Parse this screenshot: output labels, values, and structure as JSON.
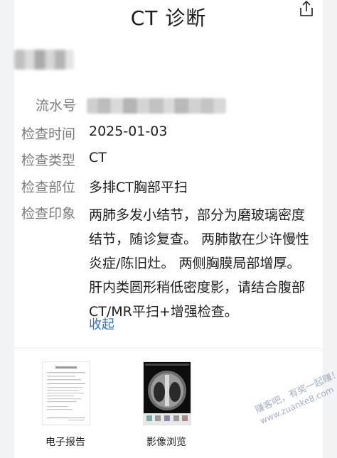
{
  "header": {
    "title": "CT 诊断",
    "share_icon": "share-icon"
  },
  "patient": {
    "name_redacted": true
  },
  "fields": {
    "serial_label": "流水号",
    "exam_time_label": "检查时间",
    "exam_time_value": "2025-01-03",
    "exam_type_label": "检查类型",
    "exam_type_value": "CT",
    "exam_site_label": "检查部位",
    "exam_site_value": "多排CT胸部平扫",
    "impression_label": "检查印象",
    "impression_value": "两肺多发小结节，部分为磨玻璃密度结节，随诊复查。 两肺散在少许慢性炎症/陈旧灶。 两侧胸膜局部增厚。 肝内类圆形稍低密度影，请结合腹部CT/MR平扫+增强检查。",
    "collapse_link": "收起"
  },
  "attachments": [
    {
      "label": "电子报告",
      "icon": "report-document-thumbnail"
    },
    {
      "label": "影像浏览",
      "icon": "ct-image-thumbnail"
    }
  ],
  "watermark": {
    "line1": "赚客吧，有奖一起赚！",
    "line2": "www.zuanke8.com"
  },
  "colors": {
    "link": "#2a73d6",
    "label": "#7b7b7b",
    "background": "#f2f3f5",
    "card": "#ffffff"
  }
}
